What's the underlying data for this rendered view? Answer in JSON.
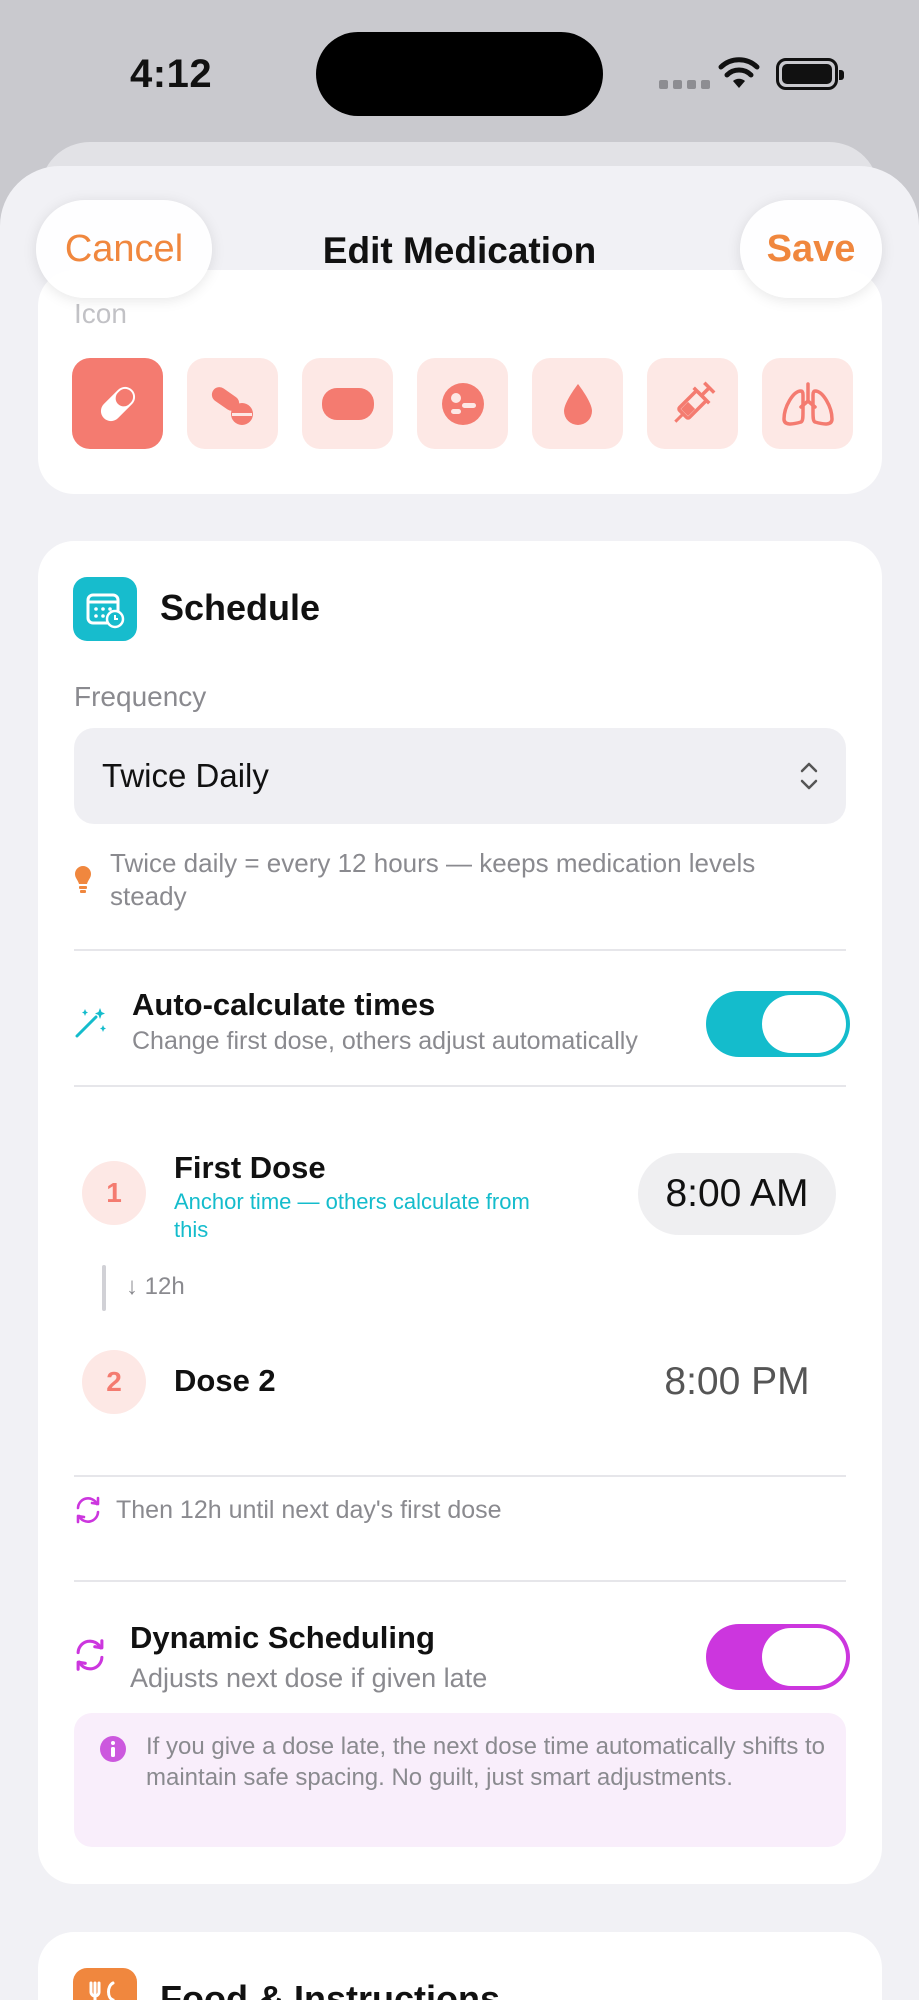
{
  "status_bar": {
    "time": "4:12"
  },
  "nav": {
    "title": "Edit Medication",
    "cancel_label": "Cancel",
    "save_label": "Save"
  },
  "colors": {
    "accent": "#f0873e",
    "icon_accent": "#f47b70",
    "teal": "#14bccc",
    "magenta": "#cc36de"
  },
  "icon_section": {
    "label": "Icon",
    "icons": [
      "pill-capsule-icon",
      "pills-icon",
      "tablet-icon",
      "round-pill-icon",
      "drop-icon",
      "syringe-icon",
      "lungs-icon"
    ],
    "selected_index": 0
  },
  "schedule": {
    "title": "Schedule",
    "frequency_label": "Frequency",
    "frequency_value": "Twice Daily",
    "hint": "Twice daily = every 12 hours — keeps medication levels steady",
    "auto_calc": {
      "title": "Auto-calculate times",
      "subtitle": "Change first dose, others adjust automatically",
      "enabled": true
    },
    "doses": [
      {
        "number": "1",
        "title": "First Dose",
        "subtitle": "Anchor time — others calculate from this",
        "time": "8:00 AM"
      },
      {
        "number": "2",
        "title": "Dose 2",
        "time": "8:00 PM"
      }
    ],
    "gap_label": "12h",
    "then_text": "Then 12h until next day's first dose",
    "dynamic": {
      "title": "Dynamic Scheduling",
      "subtitle": "Adjusts next dose if given late",
      "enabled": true
    },
    "info_text": "If you give a dose late, the next dose time automatically shifts to maintain safe spacing. No guilt, just smart adjustments."
  },
  "food_section": {
    "title": "Food & Instructions"
  }
}
